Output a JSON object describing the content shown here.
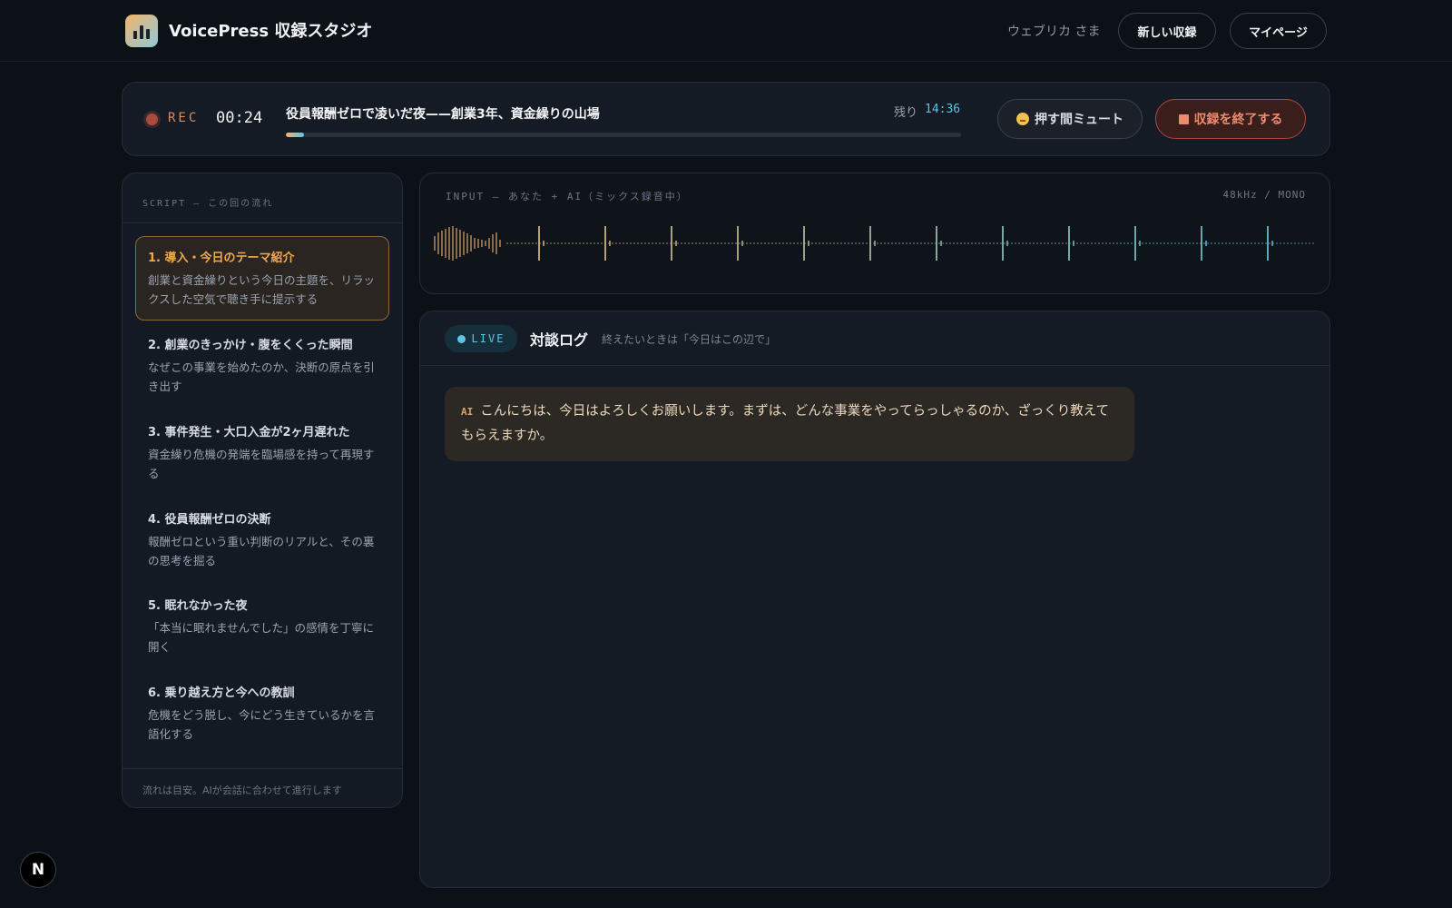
{
  "header": {
    "app_title": "VoicePress 収録スタジオ",
    "user_name": "ウェブリカ さま",
    "new_recording_label": "新しい収録",
    "mypage_label": "マイページ"
  },
  "recording": {
    "rec_label": "REC",
    "elapsed": "00:24",
    "episode_title": "役員報酬ゼロで凌いだ夜——創業3年、資金繰りの山場",
    "remaining_label": "残り",
    "remaining_time": "14:36",
    "progress_fraction": 0.027,
    "mute_label": "押す間ミュート",
    "end_label": "収録を終了する"
  },
  "script": {
    "heading": "SCRIPT — この回の流れ",
    "active_index": 0,
    "items": [
      {
        "title": "1. 導入・今日のテーマ紹介",
        "desc": "創業と資金繰りという今日の主題を、リラックスした空気で聴き手に提示する"
      },
      {
        "title": "2. 創業のきっかけ・腹をくくった瞬間",
        "desc": "なぜこの事業を始めたのか、決断の原点を引き出す"
      },
      {
        "title": "3. 事件発生・大口入金が2ヶ月遅れた",
        "desc": "資金繰り危機の発端を臨場感を持って再現する"
      },
      {
        "title": "4. 役員報酬ゼロの決断",
        "desc": "報酬ゼロという重い判断のリアルと、その裏の思考を掘る"
      },
      {
        "title": "5. 眠れなかった夜",
        "desc": "「本当に眠れませんでした」の感情を丁寧に開く"
      },
      {
        "title": "6. 乗り越え方と今への教訓",
        "desc": "危機をどう脱し、今にどう生きているかを言語化する"
      }
    ],
    "footer": "流れは目安。AIが会話に合わせて進行します"
  },
  "waveform": {
    "label": "INPUT — あなた + AI（ミックス録音中）",
    "spec": "48kHz / MONO",
    "color_start": "#f2b56b",
    "color_end": "#5cc4e6"
  },
  "log": {
    "live_label": "LIVE",
    "title": "対談ログ",
    "hint": "終えたいときは「今日はこの辺で」",
    "messages": [
      {
        "speaker": "AI",
        "text": "こんにちは、今日はよろしくお願いします。まずは、どんな事業をやってらっしゃるのか、ざっくり教えてもらえますか。"
      }
    ]
  },
  "next_badge": "N"
}
